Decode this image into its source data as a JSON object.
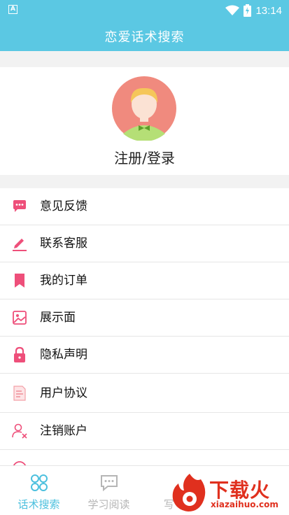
{
  "status_bar": {
    "time": "13:14"
  },
  "app_bar": {
    "title": "恋爱话术搜索"
  },
  "profile": {
    "login_label": "注册/登录"
  },
  "menu": {
    "items": [
      {
        "label": "意见反馈",
        "icon": "chat-bubble-icon"
      },
      {
        "label": "联系客服",
        "icon": "pencil-icon"
      },
      {
        "label": "我的订单",
        "icon": "bookmark-icon"
      },
      {
        "label": "展示面",
        "icon": "image-icon"
      },
      {
        "label": "隐私声明",
        "icon": "lock-icon"
      },
      {
        "label": "用户协议",
        "icon": "document-icon"
      },
      {
        "label": "注销账户",
        "icon": "user-remove-icon"
      }
    ]
  },
  "tabs": [
    {
      "label": "话术搜索",
      "icon": "grid-icon",
      "active": true
    },
    {
      "label": "学习阅读",
      "icon": "chat-icon",
      "active": false
    },
    {
      "label": "写",
      "icon": "edit-icon",
      "active": false
    }
  ],
  "watermark": {
    "text": "下载火",
    "sub": "xiazaihuo.com"
  },
  "colors": {
    "primary": "#5bc8e3",
    "icon_pink": "#ee4f7a",
    "tab_active": "#4cc0de",
    "tab_inactive": "#b5b5b5",
    "watermark_red": "#e0301e"
  }
}
